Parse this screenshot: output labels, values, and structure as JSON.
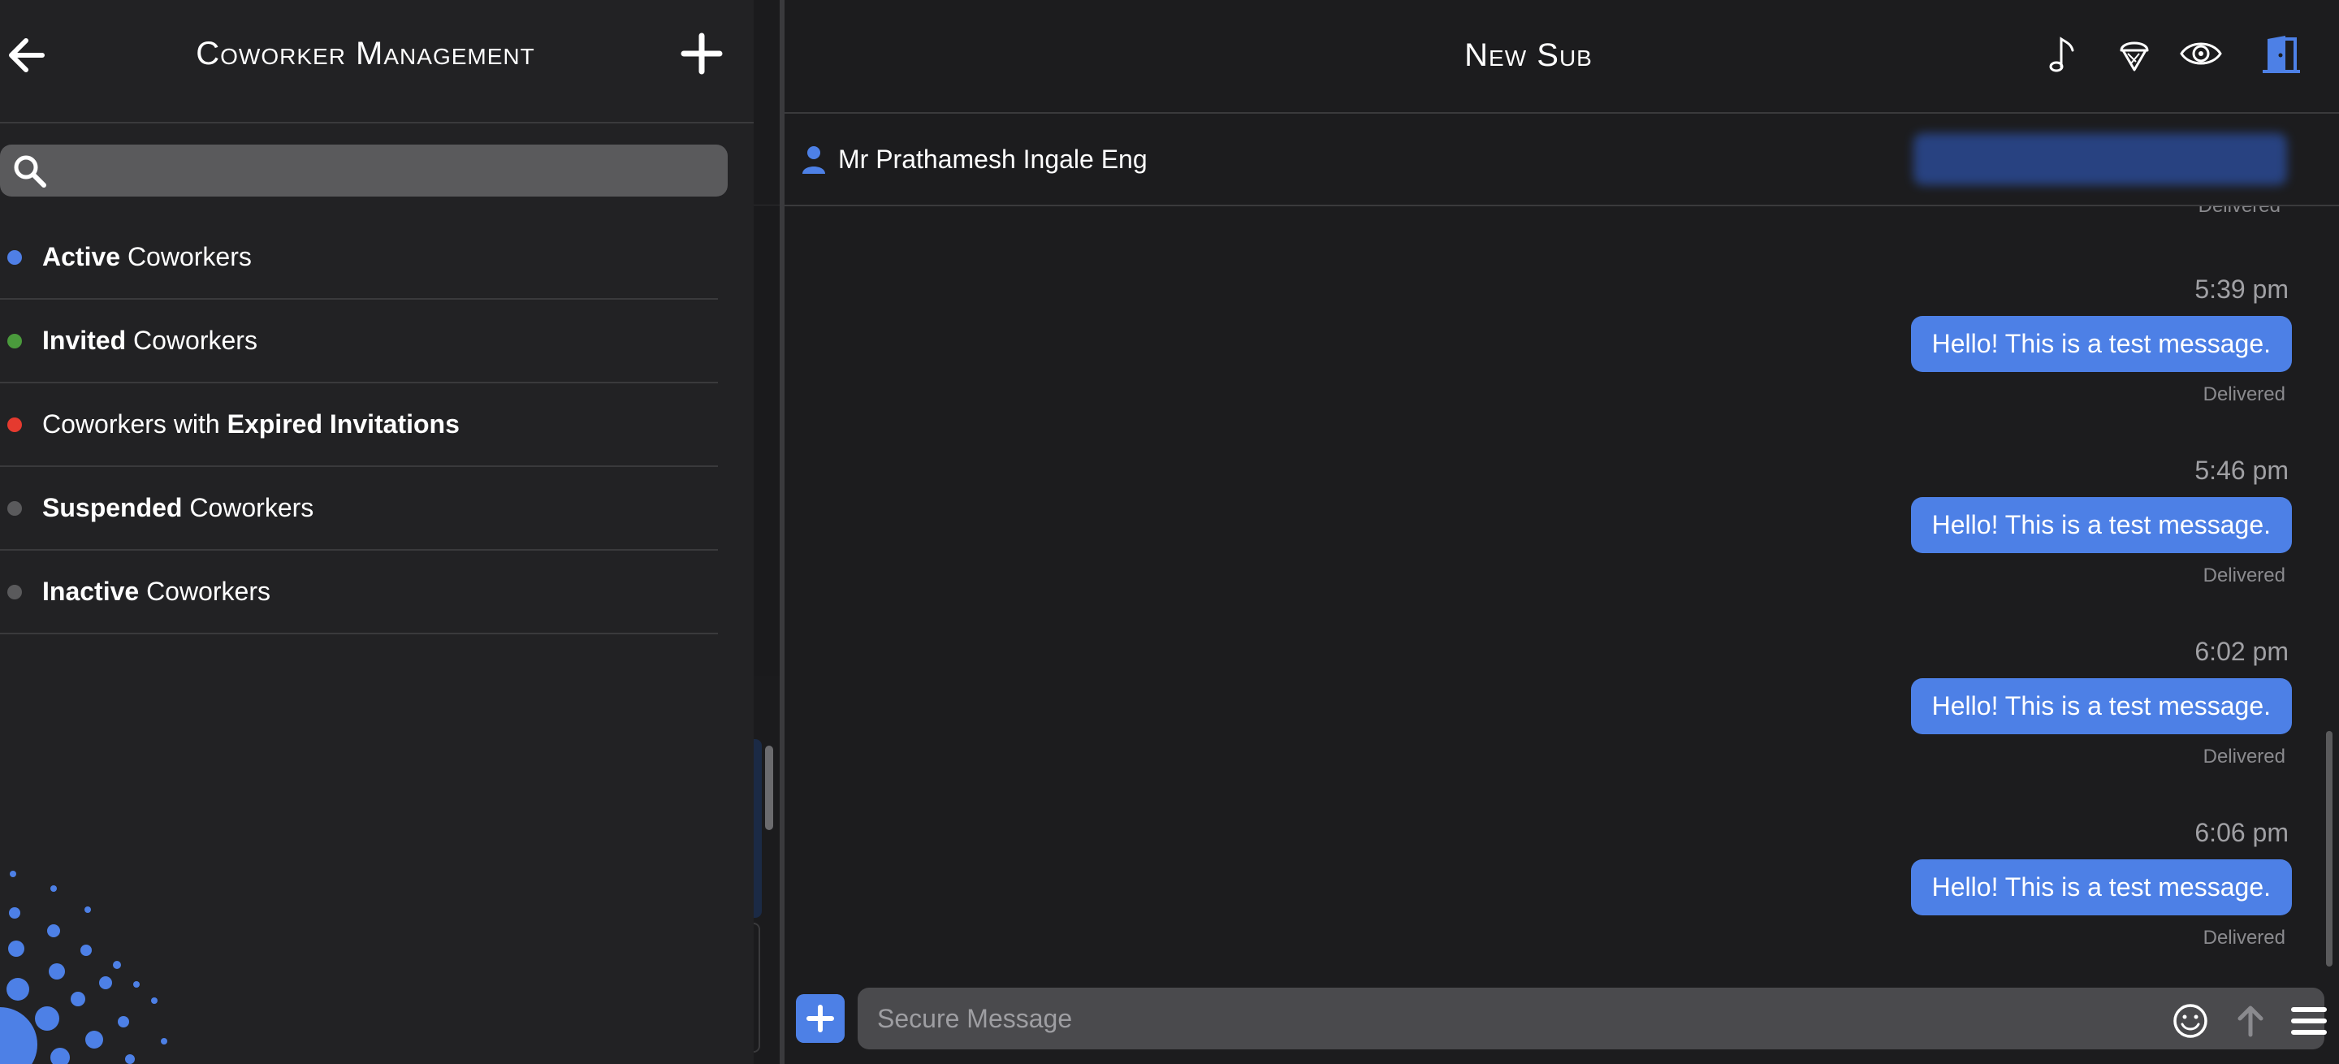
{
  "sidebar": {
    "title": "Coworker Management",
    "search_placeholder": "",
    "items": [
      {
        "bold": "Active",
        "rest": " Coworkers",
        "dot_color": "#4f7fe6"
      },
      {
        "bold": "Invited",
        "rest": " Coworkers",
        "dot_color": "#4a9a3c"
      },
      {
        "prefix": "Coworkers with ",
        "bold": "Expired Invitations",
        "dot_color": "#e53a2f"
      },
      {
        "bold": "Suspended",
        "rest": " Coworkers",
        "dot_color": "#5a5a5c"
      },
      {
        "bold": "Inactive",
        "rest": " Coworkers",
        "dot_color": "#5a5a5c"
      }
    ]
  },
  "chat": {
    "title": "New Sub",
    "contact_name": "Mr Prathamesh Ingale Eng",
    "header_icons": [
      "music-note-icon",
      "ice-cream-icon",
      "eye-icon",
      "exit-door-icon"
    ],
    "messages": [
      {
        "time": "5:39 pm",
        "text": "Hello! This is a test message.",
        "status": "Delivered"
      },
      {
        "time": "5:46 pm",
        "text": "Hello! This is a test message.",
        "status": "Delivered"
      },
      {
        "time": "6:02 pm",
        "text": "Hello! This is a test message.",
        "status": "Delivered"
      },
      {
        "time": "6:06 pm",
        "text": "Hello! This is a test message.",
        "status": "Delivered"
      }
    ],
    "partial_status": "Delivered",
    "composer": {
      "placeholder": "Secure Message"
    }
  },
  "colors": {
    "accent": "#4d80e6",
    "background": "#1c1c1e"
  }
}
